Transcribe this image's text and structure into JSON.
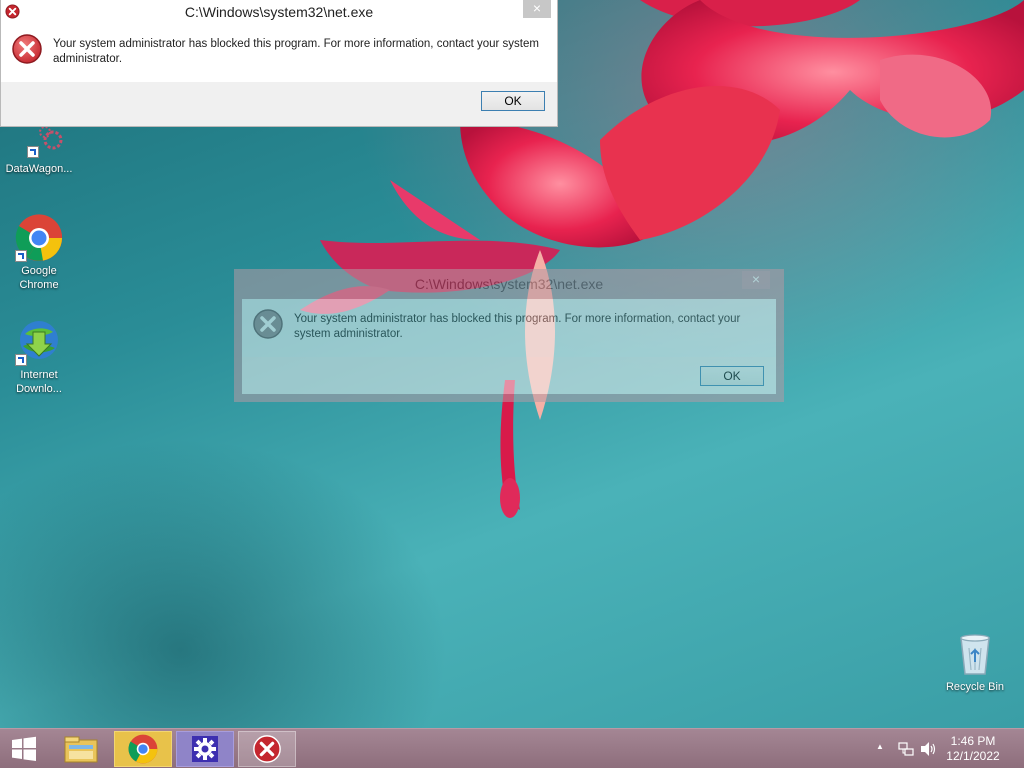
{
  "desktop": {
    "icons": [
      {
        "label": "DataWagon..."
      },
      {
        "label": "Google\nChrome"
      },
      {
        "label": "Internet\nDownlo..."
      },
      {
        "label": "Recycle Bin"
      }
    ]
  },
  "dialog_front": {
    "title": "C:\\Windows\\system32\\net.exe",
    "close_glyph": "×",
    "message": "Your system administrator has blocked this program. For more information, contact your system administrator.",
    "ok_label": "OK"
  },
  "dialog_ghost": {
    "title": "C:\\Windows\\system32\\net.exe",
    "close_glyph": "×",
    "message": "Your system administrator has blocked this program. For more information, contact your system administrator.",
    "ok_label": "OK"
  },
  "taskbar": {
    "pinned": [
      {
        "icon": "start-icon"
      },
      {
        "icon": "file-explorer-icon"
      },
      {
        "icon": "chrome-icon"
      },
      {
        "icon": "settings-gear-icon"
      },
      {
        "icon": "error-icon"
      }
    ],
    "tray": {
      "time": "1:46 PM",
      "date": "12/1/2022",
      "overflow_glyph": "▲"
    }
  },
  "colors": {
    "error_red": "#c4262e",
    "ok_border": "#3c7fb1",
    "taskbar": "#9a7a88"
  }
}
